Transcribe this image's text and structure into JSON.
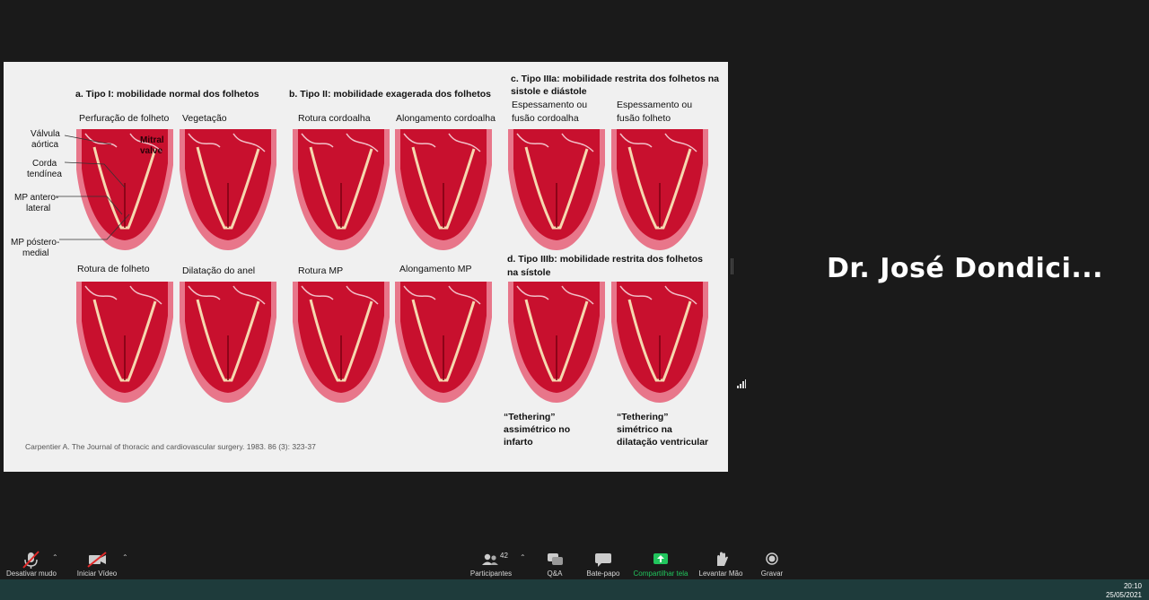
{
  "speaker": {
    "name": "Dr. José Dondici..."
  },
  "slide": {
    "sections": {
      "a": "a. Tipo I: mobilidade normal dos folhetos",
      "b": "b. Tipo II: mobilidade exagerada dos folhetos",
      "c_line1": "c. Tipo IIIa: mobilidade restrita dos folhetos na",
      "c_line2": "sistole e diástole",
      "d_line1": "d. Tipo IIIb: mobilidade restrita dos folhetos",
      "d_line2": "na sístole"
    },
    "labels": {
      "perfuracao": "Perfuração de folheto",
      "vegetacao": "Vegetação",
      "rotura_cordoalha": "Rotura cordoalha",
      "alongamento_cordoalha": "Alongamento cordoalha",
      "espessamento_cordoalha_1": "Espessamento ou",
      "espessamento_cordoalha_2": "fusão cordoalha",
      "espessamento_folheto_1": "Espessamento ou",
      "espessamento_folheto_2": "fusão folheto",
      "rotura_folheto": "Rotura de folheto",
      "dilatacao_anel": "Dilatação do anel",
      "rotura_mp": "Rotura MP",
      "alongamento_mp": "Alongamento MP"
    },
    "anatomy": {
      "valvula_1": "Válvula",
      "valvula_2": "aórtica",
      "corda_1": "Corda",
      "corda_2": "tendínea",
      "mp_antero_1": "MP antero-",
      "mp_antero_2": "lateral",
      "mp_postero_1": "MP póstero-",
      "mp_postero_2": "medial",
      "mitral_1": "Mitral",
      "mitral_2": "valve"
    },
    "captions": {
      "tethering_left_1": "“Tethering”",
      "tethering_left_2": "assimétrico no",
      "tethering_left_3": "infarto",
      "tethering_right_1": "“Tethering”",
      "tethering_right_2": "simétrico na",
      "tethering_right_3": "dilatação ventricular"
    },
    "citation": "Carpentier A. The Journal of thoracic and cardiovascular surgery. 1983. 86 (3): 323-37"
  },
  "toolbar": {
    "mute": "Desativar mudo",
    "video": "Iniciar Vídeo",
    "participants": "Participantes",
    "participants_count": "42",
    "qa": "Q&A",
    "chat": "Bate-papo",
    "share": "Compartilhar tela",
    "raise_hand": "Levantar Mão",
    "record": "Gravar"
  },
  "clock": {
    "time": "20:10",
    "date": "25/05/2021"
  },
  "colors": {
    "heart_red": "#c8102e",
    "heart_pink": "#e8768a",
    "share_green": "#21c55d",
    "taskbar": "#1e3b3b"
  }
}
